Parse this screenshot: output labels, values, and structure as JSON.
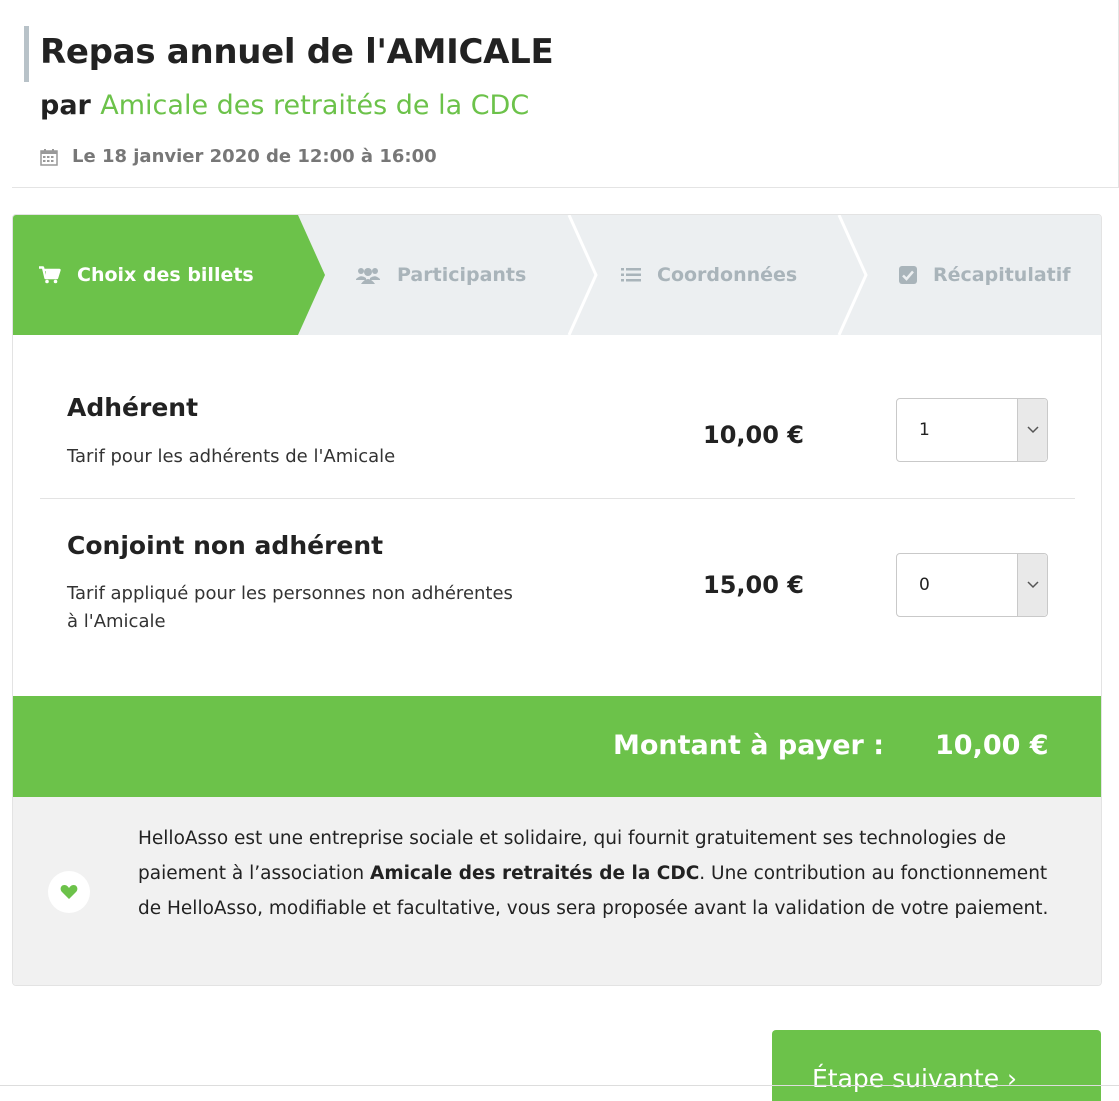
{
  "event": {
    "title": "Repas annuel de l'AMICALE",
    "by_prefix": "par",
    "organizer": "Amicale des retraités de la CDC",
    "date": "Le 18 janvier 2020 de 12:00 à 16:00"
  },
  "steps": [
    {
      "label": "Choix des billets",
      "icon": "cart-icon",
      "active": true
    },
    {
      "label": "Participants",
      "icon": "users-icon",
      "active": false
    },
    {
      "label": "Coordonnées",
      "icon": "list-icon",
      "active": false
    },
    {
      "label": "Récapitulatif",
      "icon": "check-square-icon",
      "active": false
    }
  ],
  "tickets": [
    {
      "name": "Adhérent",
      "description": "Tarif pour les adhérents de l'Amicale",
      "price": "10,00 €",
      "quantity": "1"
    },
    {
      "name": "Conjoint non adhérent",
      "description": "Tarif appliqué pour les personnes non adhérentes à l'Amicale",
      "price": "15,00 €",
      "quantity": "0"
    }
  ],
  "total": {
    "label": "Montant à payer :",
    "value": "10,00 €"
  },
  "info": {
    "text_before": "HelloAsso est une entreprise sociale et solidaire, qui fournit gratuitement ses technologies de paiement à l’association ",
    "association": "Amicale des retraités de la CDC",
    "text_after": ". Une contribution au fonctionnement de HelloAsso, modifiable et facultative, vous sera proposée avant la validation de votre paiement."
  },
  "next_button": {
    "label": "Étape suivante ›"
  },
  "colors": {
    "accent": "#6cc24a",
    "step_inactive_bg": "#eceff1",
    "step_inactive_text": "#a9b4ba",
    "info_bg": "#f1f1f1"
  }
}
